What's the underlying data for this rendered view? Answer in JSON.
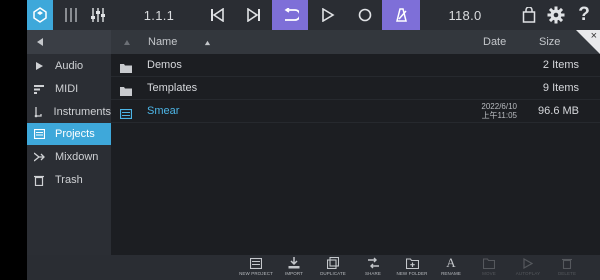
{
  "toolbar": {
    "position": "1.1.1",
    "tempo": "118.0",
    "colors": {
      "accent": "#3ea8da",
      "transport_active": "#7e6fd8"
    },
    "icons": [
      "app-logo-icon",
      "mixer-icon",
      "fader-icon",
      "skip-back-icon",
      "skip-forward-icon",
      "loop-icon",
      "play-icon",
      "record-icon",
      "metronome-icon",
      "store-icon",
      "settings-icon",
      "help-icon"
    ]
  },
  "header": {
    "name_col": "Name",
    "date_col": "Date",
    "size_col": "Size",
    "close_glyph": "×"
  },
  "sidebar": {
    "items": [
      {
        "label": "Audio",
        "icon": "audio-icon"
      },
      {
        "label": "MIDI",
        "icon": "midi-icon"
      },
      {
        "label": "Instruments",
        "icon": "instruments-icon"
      },
      {
        "label": "Projects",
        "icon": "projects-icon",
        "active": true
      },
      {
        "label": "Mixdown",
        "icon": "mixdown-icon"
      },
      {
        "label": "Trash",
        "icon": "trash-icon"
      }
    ]
  },
  "files": [
    {
      "name": "Demos",
      "type": "folder",
      "date": "",
      "time": "",
      "size": "2 Items"
    },
    {
      "name": "Templates",
      "type": "folder",
      "date": "",
      "time": "",
      "size": "9 Items"
    },
    {
      "name": "Smear",
      "type": "project",
      "date": "2022/6/10",
      "time": "上午11:05",
      "size": "96.6 MB"
    }
  ],
  "bottom_actions": [
    {
      "label": "NEW PROJECT",
      "icon": "new-project-icon",
      "enabled": true
    },
    {
      "label": "IMPORT",
      "icon": "import-icon",
      "enabled": true
    },
    {
      "label": "DUPLICATE",
      "icon": "duplicate-icon",
      "enabled": true
    },
    {
      "label": "SHARE",
      "icon": "share-icon",
      "enabled": true
    },
    {
      "label": "NEW FOLDER",
      "icon": "new-folder-icon",
      "enabled": true
    },
    {
      "label": "RENAME",
      "icon": "rename-icon",
      "enabled": true
    },
    {
      "label": "MOVE",
      "icon": "move-icon",
      "enabled": false
    },
    {
      "label": "AUTOPLAY",
      "icon": "autoplay-icon",
      "enabled": false
    },
    {
      "label": "DELETE",
      "icon": "delete-icon",
      "enabled": false
    }
  ]
}
